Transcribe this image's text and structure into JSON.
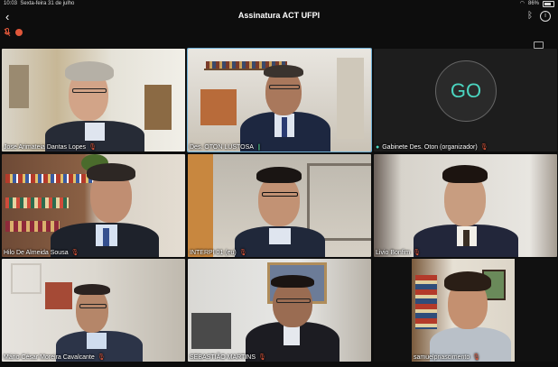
{
  "status": {
    "time": "10:03",
    "date": "Sexta-feira 31 de julho",
    "battery": "86%"
  },
  "header": {
    "title": "Assinatura ACT UFPI",
    "back": "‹",
    "info": "i",
    "bluetooth": "ᛒ"
  },
  "participants": [
    {
      "name": "Jose Arimateia Dantas Lopes",
      "mic": "muted"
    },
    {
      "name": "Des. OTON LUSTOSA",
      "mic": "speaking"
    },
    {
      "name": "Gabinete Des. Oton (organizador)",
      "mic": "muted",
      "avatar": "GO"
    },
    {
      "name": "Hilo De Almeida Sousa",
      "mic": "muted"
    },
    {
      "name": "INTERPI 01 (eu)",
      "mic": "muted"
    },
    {
      "name": "Livio Bonfim",
      "mic": "muted"
    },
    {
      "name": "Mário César Moreira Cavalcante",
      "mic": "muted"
    },
    {
      "name": "SEBASTIÃO MARTINS",
      "mic": "muted"
    },
    {
      "name": "samuelpnascimento",
      "mic": "muted"
    }
  ],
  "colors": {
    "accent_border": "#6fb0d6",
    "mic_muted": "#e0573a",
    "go_text": "#4bd5c0"
  }
}
